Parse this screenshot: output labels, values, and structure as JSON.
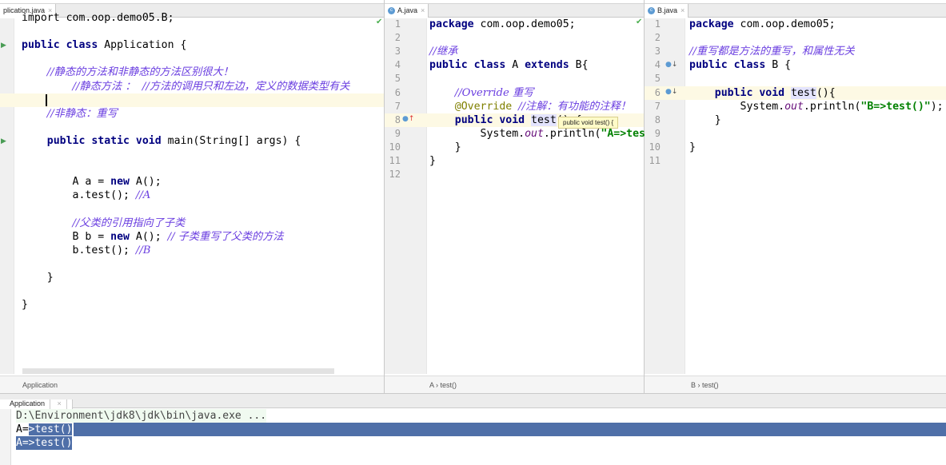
{
  "panes": [
    {
      "id": "app",
      "tab": "plication.java",
      "breadcrumb": "Application",
      "show_numbers": false,
      "first_line_num": 0,
      "lines": [
        [
          [
            "",
            "import com.oop.demo05.B;"
          ]
        ],
        [],
        [
          [
            "kw",
            "public class "
          ],
          [
            "",
            "Application {"
          ]
        ],
        [],
        [
          [
            "",
            "    "
          ],
          [
            "cm",
            "//静态的方法和非静态的方法区别很大！"
          ]
        ],
        [
          [
            "",
            "        "
          ],
          [
            "cm",
            "//静态方法 ：  //方法的调用只和左边，定义的数据类型有关"
          ]
        ],
        [],
        [
          [
            "",
            "    "
          ],
          [
            "cm",
            "//非静态：重写"
          ]
        ],
        [],
        [
          [
            "",
            "    "
          ],
          [
            "kw",
            "public static void "
          ],
          [
            "",
            "main(String[] args) {"
          ]
        ],
        [],
        [],
        [
          [
            "",
            "        A a = "
          ],
          [
            "kw",
            "new "
          ],
          [
            "",
            "A();"
          ]
        ],
        [
          [
            "",
            "        a.test(); "
          ],
          [
            "cm",
            "//A"
          ]
        ],
        [],
        [
          [
            "",
            "        "
          ],
          [
            "cm",
            "//父类的引用指向了子类"
          ]
        ],
        [
          [
            "",
            "        B b = "
          ],
          [
            "kw",
            "new "
          ],
          [
            "",
            "A(); "
          ],
          [
            "cm",
            "// 子类重写了父类的方法"
          ]
        ],
        [
          [
            "",
            "        b.test(); "
          ],
          [
            "cm",
            "//B"
          ]
        ],
        [],
        [
          [
            "",
            "    }"
          ]
        ],
        [],
        [
          [
            "",
            "}"
          ]
        ]
      ]
    },
    {
      "id": "a",
      "tab": "A.java",
      "breadcrumb": "A  ›  test()",
      "show_numbers": true,
      "lines": [
        [
          [
            "kw",
            "package "
          ],
          [
            "",
            "com.oop.demo05;"
          ]
        ],
        [],
        [
          [
            "cm",
            "//继承"
          ]
        ],
        [
          [
            "kw",
            "public class "
          ],
          [
            "",
            "A "
          ],
          [
            "kw",
            "extends "
          ],
          [
            "",
            "B{"
          ]
        ],
        [],
        [
          [
            "",
            "    "
          ],
          [
            "cm",
            "//Override 重写"
          ]
        ],
        [
          [
            "",
            "    "
          ],
          [
            "an",
            "@Override "
          ],
          [
            "cm",
            "//注解：有功能的注释！"
          ]
        ],
        [
          [
            "",
            "    "
          ],
          [
            "kw",
            "public void "
          ],
          [
            "hl",
            "test"
          ],
          [
            "",
            "() {"
          ]
        ],
        [
          [
            "",
            "        System."
          ],
          [
            "it",
            "out"
          ],
          [
            "",
            ".println("
          ],
          [
            "st",
            "\"A=>test()\""
          ],
          [
            "",
            ");"
          ]
        ],
        [
          [
            "",
            "    }"
          ]
        ],
        [
          [
            "",
            "}"
          ]
        ],
        []
      ]
    },
    {
      "id": "b",
      "tab": "B.java",
      "breadcrumb": "B  ›  test()",
      "show_numbers": true,
      "lines": [
        [
          [
            "kw",
            "package "
          ],
          [
            "",
            "com.oop.demo05;"
          ]
        ],
        [],
        [
          [
            "cm",
            "//重写都是方法的重写，和属性无关"
          ]
        ],
        [
          [
            "kw",
            "public class "
          ],
          [
            "",
            "B {"
          ]
        ],
        [],
        [
          [
            "",
            "    "
          ],
          [
            "kw",
            "public void "
          ],
          [
            "hl",
            "test"
          ],
          [
            "",
            "(){"
          ]
        ],
        [
          [
            "",
            "        System."
          ],
          [
            "it",
            "out"
          ],
          [
            "",
            ".println("
          ],
          [
            "st",
            "\"B=>test()\""
          ],
          [
            "",
            ");"
          ]
        ],
        [
          [
            "",
            "    }"
          ]
        ],
        [],
        [
          [
            "",
            "}"
          ]
        ],
        []
      ]
    }
  ],
  "tooltip": "public void test() {",
  "console": {
    "tab": "Application",
    "lines": [
      "D:\\Environment\\jdk8\\jdk\\bin\\java.exe ...",
      "A=>test()",
      "A=>test()"
    ]
  }
}
